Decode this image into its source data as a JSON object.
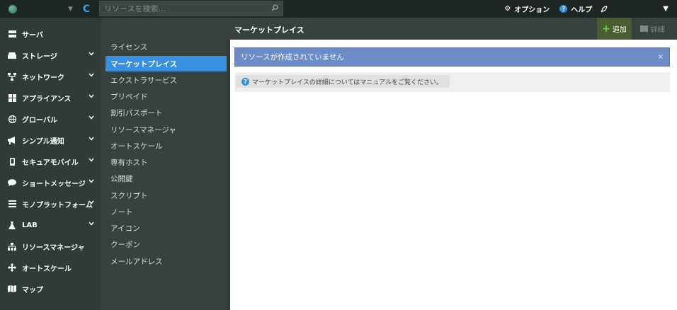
{
  "topbar": {
    "search_placeholder": "リソースを検索...",
    "option_label": "オプション",
    "help_label": "ヘルプ"
  },
  "leftnav": {
    "items": [
      {
        "label": "サーバ",
        "icon": "server-icon",
        "expandable": false
      },
      {
        "label": "ストレージ",
        "icon": "storage-icon",
        "expandable": true
      },
      {
        "label": "ネットワーク",
        "icon": "network-icon",
        "expandable": true
      },
      {
        "label": "アプライアンス",
        "icon": "appliance-icon",
        "expandable": true
      },
      {
        "label": "グローバル",
        "icon": "globe-icon",
        "expandable": true
      },
      {
        "label": "シンプル通知",
        "icon": "megaphone-icon",
        "expandable": true
      },
      {
        "label": "セキュアモバイル",
        "icon": "mobile-icon",
        "expandable": true
      },
      {
        "label": "ショートメッセージ",
        "icon": "chat-icon",
        "expandable": true
      },
      {
        "label": "モノプラットフォーム",
        "icon": "layers-icon",
        "expandable": true
      },
      {
        "label": "LAB",
        "icon": "flask-icon",
        "expandable": true
      },
      {
        "label": "リソースマネージャ",
        "icon": "sitemap-icon",
        "expandable": false
      },
      {
        "label": "オートスケール",
        "icon": "arrows-icon",
        "expandable": false
      },
      {
        "label": "マップ",
        "icon": "map-icon",
        "expandable": false
      }
    ]
  },
  "subnav": {
    "items": [
      {
        "label": "ライセンス",
        "active": false
      },
      {
        "label": "マーケットプレイス",
        "active": true
      },
      {
        "label": "エクストラサービス",
        "active": false
      },
      {
        "label": "プリペイド",
        "active": false
      },
      {
        "label": "割引パスポート",
        "active": false
      },
      {
        "label": "リソースマネージャ",
        "active": false
      },
      {
        "label": "オートスケール",
        "active": false
      },
      {
        "label": "専有ホスト",
        "active": false
      },
      {
        "label": "公開鍵",
        "active": false
      },
      {
        "label": "スクリプト",
        "active": false
      },
      {
        "label": "ノート",
        "active": false
      },
      {
        "label": "アイコン",
        "active": false
      },
      {
        "label": "クーポン",
        "active": false
      },
      {
        "label": "メールアドレス",
        "active": false
      }
    ]
  },
  "main": {
    "title": "マーケットプレイス",
    "add_label": "追加",
    "detail_label": "詳細",
    "notice_text": "リソースが作成されていません",
    "notice_close": "×",
    "info_text": "マーケットプレイスの詳細についてはマニュアルをご覧ください。"
  },
  "colors": {
    "accent": "#3a8fdf",
    "add_button": "#4a5c31",
    "notice": "#6b8cc7"
  }
}
